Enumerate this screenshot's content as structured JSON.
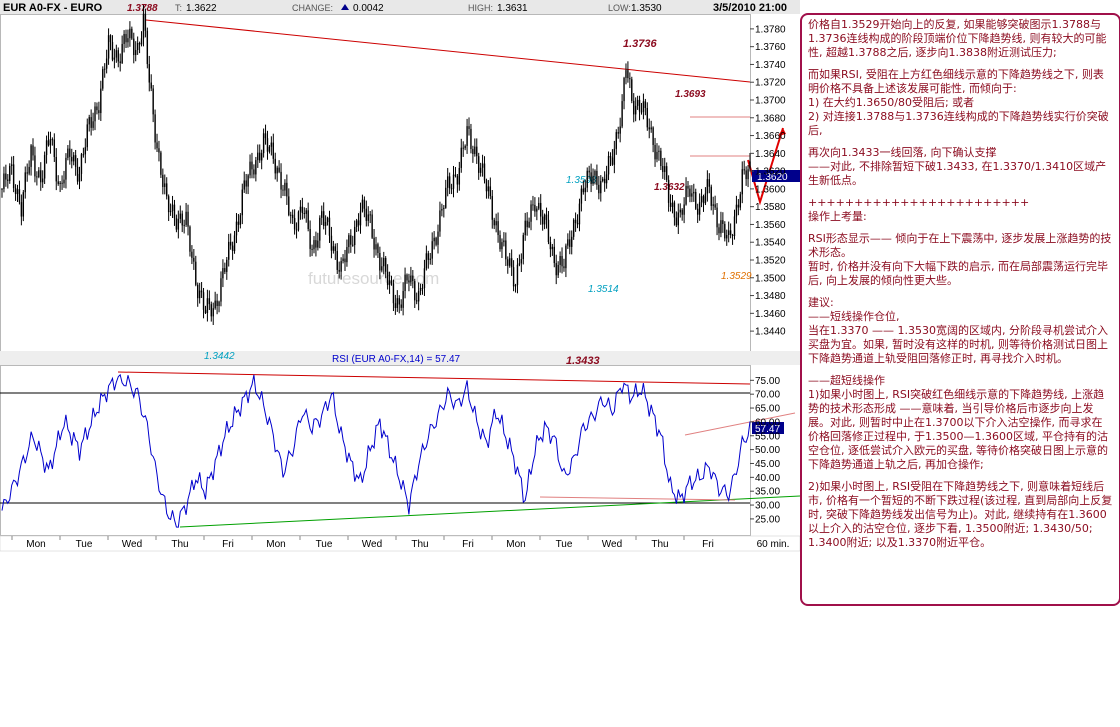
{
  "header": {
    "symbol": "EUR A0-FX - EURO",
    "open_label": "1.3788",
    "last_label": "T:",
    "last_value": "1.3622",
    "change_label": "CHANGE:",
    "change_value": "0.0042",
    "high_label": "HIGH:",
    "high_value": "1.3631",
    "low_label": "LOW:",
    "low_value": "1.3530",
    "datetime": "3/5/2010 21:00"
  },
  "colors": {
    "background": "#ffffff",
    "price": "#000000",
    "rsi": "#0000cc",
    "trendline": "#cc0000",
    "support": "#00a000",
    "annotation_dark": "#8b0a1e",
    "annotation_cyan": "#00a0c0",
    "annotation_orange": "#e07000",
    "accent_arrow": "#e00000",
    "current_price_bg": "#00008b"
  },
  "chart_data": [
    {
      "type": "candlestick",
      "title": "EUR A0-FX - EURO",
      "ylim": [
        1.343,
        1.379
      ],
      "y_ticks": [
        "1.3780",
        "1.3760",
        "1.3740",
        "1.3720",
        "1.3700",
        "1.3680",
        "1.3660",
        "1.3640",
        "1.3620",
        "1.3600",
        "1.3580",
        "1.3560",
        "1.3540",
        "1.3520",
        "1.3500",
        "1.3480",
        "1.3460",
        "1.3440"
      ],
      "current_price": "1.3620",
      "x_labels": [
        "Mon",
        "Tue",
        "Wed",
        "Thu",
        "Fri",
        "Mon",
        "Tue",
        "Wed",
        "Thu",
        "Fri",
        "Mon",
        "Tue",
        "Wed",
        "Thu",
        "Fri",
        "60 min."
      ],
      "close_path": [
        [
          0,
          1.36
        ],
        [
          5,
          1.362
        ],
        [
          10,
          1.358
        ],
        [
          15,
          1.364
        ],
        [
          20,
          1.361
        ],
        [
          25,
          1.366
        ],
        [
          30,
          1.36
        ],
        [
          35,
          1.364
        ],
        [
          40,
          1.362
        ],
        [
          45,
          1.367
        ],
        [
          50,
          1.37
        ],
        [
          55,
          1.376
        ],
        [
          60,
          1.375
        ],
        [
          65,
          1.377
        ],
        [
          70,
          1.376
        ],
        [
          73,
          1.3788
        ],
        [
          76,
          1.372
        ],
        [
          80,
          1.365
        ],
        [
          85,
          1.358
        ],
        [
          90,
          1.357
        ],
        [
          95,
          1.356
        ],
        [
          100,
          1.35
        ],
        [
          105,
          1.346
        ],
        [
          110,
          1.347
        ],
        [
          115,
          1.351
        ],
        [
          120,
          1.355
        ],
        [
          125,
          1.36
        ],
        [
          130,
          1.363
        ],
        [
          135,
          1.365
        ],
        [
          140,
          1.364
        ],
        [
          145,
          1.36
        ],
        [
          150,
          1.356
        ],
        [
          155,
          1.358
        ],
        [
          160,
          1.353
        ],
        [
          165,
          1.357
        ],
        [
          170,
          1.354
        ],
        [
          175,
          1.351
        ],
        [
          180,
          1.354
        ],
        [
          185,
          1.358
        ],
        [
          190,
          1.356
        ],
        [
          195,
          1.352
        ],
        [
          200,
          1.349
        ],
        [
          205,
          1.347
        ],
        [
          210,
          1.35
        ],
        [
          215,
          1.348
        ],
        [
          220,
          1.352
        ],
        [
          225,
          1.356
        ],
        [
          230,
          1.36
        ],
        [
          235,
          1.362
        ],
        [
          240,
          1.366
        ],
        [
          245,
          1.364
        ],
        [
          250,
          1.36
        ],
        [
          255,
          1.356
        ],
        [
          260,
          1.352
        ],
        [
          265,
          1.35
        ],
        [
          270,
          1.355
        ],
        [
          275,
          1.359
        ],
        [
          280,
          1.356
        ],
        [
          285,
          1.352
        ],
        [
          290,
          1.3514
        ],
        [
          295,
          1.356
        ],
        [
          300,
          1.3598
        ],
        [
          305,
          1.362
        ],
        [
          310,
          1.36
        ],
        [
          315,
          1.364
        ],
        [
          320,
          1.369
        ],
        [
          322,
          1.3736
        ],
        [
          325,
          1.37
        ],
        [
          330,
          1.3693
        ],
        [
          335,
          1.366
        ],
        [
          340,
          1.3632
        ],
        [
          345,
          1.358
        ],
        [
          350,
          1.357
        ],
        [
          355,
          1.36
        ],
        [
          360,
          1.358
        ],
        [
          365,
          1.36
        ],
        [
          370,
          1.356
        ],
        [
          375,
          1.354
        ],
        [
          378,
          1.357
        ],
        [
          382,
          1.361
        ],
        [
          386,
          1.362
        ]
      ],
      "annotations": [
        "1.3788",
        "1.3736",
        "1.3693",
        "1.3598",
        "1.3632",
        "1.3514",
        "1.3529",
        "1.3442",
        "1.3433"
      ],
      "watermark": "futuresource.com"
    },
    {
      "type": "line",
      "title": "RSI (EUR A0-FX,14) = 57.47",
      "ylim": [
        21,
        78
      ],
      "y_ticks": [
        "75.00",
        "70.00",
        "65.00",
        "60.00",
        "55.00",
        "50.00",
        "45.00",
        "40.00",
        "35.00",
        "30.00",
        "25.00"
      ],
      "current_value": "57.47",
      "reference_lines": [
        70,
        30
      ],
      "series": [
        {
          "name": "RSI",
          "points": [
            [
              0,
              28
            ],
            [
              8,
              40
            ],
            [
              16,
              55
            ],
            [
              24,
              42
            ],
            [
              32,
              60
            ],
            [
              40,
              50
            ],
            [
              50,
              66
            ],
            [
              55,
              72
            ],
            [
              60,
              76
            ],
            [
              65,
              74
            ],
            [
              70,
              70
            ],
            [
              75,
              58
            ],
            [
              80,
              40
            ],
            [
              85,
              28
            ],
            [
              90,
              23
            ],
            [
              95,
              30
            ],
            [
              100,
              40
            ],
            [
              105,
              35
            ],
            [
              110,
              45
            ],
            [
              115,
              55
            ],
            [
              120,
              62
            ],
            [
              125,
              68
            ],
            [
              130,
              74
            ],
            [
              135,
              66
            ],
            [
              140,
              55
            ],
            [
              145,
              42
            ],
            [
              150,
              50
            ],
            [
              155,
              64
            ],
            [
              160,
              58
            ],
            [
              165,
              62
            ],
            [
              170,
              70
            ],
            [
              175,
              55
            ],
            [
              180,
              45
            ],
            [
              185,
              38
            ],
            [
              190,
              50
            ],
            [
              195,
              60
            ],
            [
              200,
              50
            ],
            [
              205,
              40
            ],
            [
              210,
              30
            ],
            [
              215,
              45
            ],
            [
              220,
              55
            ],
            [
              225,
              62
            ],
            [
              230,
              70
            ],
            [
              235,
              66
            ],
            [
              240,
              72
            ],
            [
              245,
              60
            ],
            [
              250,
              52
            ],
            [
              255,
              64
            ],
            [
              260,
              55
            ],
            [
              265,
              45
            ],
            [
              270,
              32
            ],
            [
              275,
              50
            ],
            [
              280,
              58
            ],
            [
              285,
              54
            ],
            [
              290,
              40
            ],
            [
              295,
              46
            ],
            [
              300,
              58
            ],
            [
              305,
              62
            ],
            [
              310,
              68
            ],
            [
              315,
              64
            ],
            [
              320,
              74
            ],
            [
              325,
              69
            ],
            [
              330,
              72
            ],
            [
              335,
              64
            ],
            [
              340,
              55
            ],
            [
              345,
              36
            ],
            [
              350,
              32
            ],
            [
              355,
              38
            ],
            [
              360,
              40
            ],
            [
              365,
              44
            ],
            [
              370,
              36
            ],
            [
              375,
              34
            ],
            [
              378,
              40
            ],
            [
              382,
              52
            ],
            [
              386,
              57.47
            ]
          ]
        }
      ]
    }
  ],
  "commentary": {
    "paragraph_1": "价格自1.3529开始向上的反复, 如果能够突破图示1.3788与1.3736连线构成的阶段顶端价位下降趋势线, 则有较大的可能性, 超越1.3788之后, 逐步向1.3838附近测试压力;",
    "paragraph_2": "而如果RSI, 受阻在上方红色细线示意的下降趋势线之下, 则表明价格不具备上述该发展可能性, 而倾向于:\n1) 在大约1.3650/80受阻后; 或者\n2) 对连接1.3788与1.3736连线构成的下降趋势线实行价突破后,",
    "paragraph_3": "再次向1.3433一线回落, 向下确认支撑\n——对此, 不排除暂短下破1.3433, 在1.3370/1.3410区域产生新低点。",
    "separator": "++++++++++++++++++++++++",
    "ops_title": "操作上考量:",
    "paragraph_4": "RSI形态显示—— 倾向于在上下震荡中, 逐步发展上涨趋势的技术形态。\n暂时, 价格并没有向下大幅下跌的启示, 而在局部震荡运行完毕后, 向上发展的倾向性更大些。",
    "advice_title": "建议:",
    "paragraph_5": "——短线操作仓位,\n当在1.3370 —— 1.3530宽阔的区域内, 分阶段寻机尝试介入买盘为宜。如果, 暂时没有这样的时机, 则等待价格测试日图上下降趋势通道上轨受阻回落修正时, 再寻找介入时机。",
    "paragraph_6": "——超短线操作\n1)如果小时图上, RSI突破红色细线示意的下降趋势线, 上涨趋势的技术形态形成 ——意味着, 当引导价格后市逐步向上发展。对此, 则暂时中止在1.3700以下介入沽空操作, 而寻求在价格回落修正过程中, 于1.3500—1.3600区域, 平仓持有的沽空仓位, 逐低尝试介入欧元的买盘, 等待价格突破日图上示意的下降趋势通道上轨之后, 再加仓操作;",
    "paragraph_7": "2)如果小时图上, RSI受阻在下降趋势线之下, 则意味着短线后市, 价格有一个暂短的不断下跌过程(该过程, 直到局部向上反复时, 突破下降趋势线发出信号为止)。对此, 继续持有在1.3600以上介入的沽空仓位, 逐步下看, 1.3500附近; 1.3430/50; 1.3400附近; 以及1.3370附近平仓。"
  }
}
